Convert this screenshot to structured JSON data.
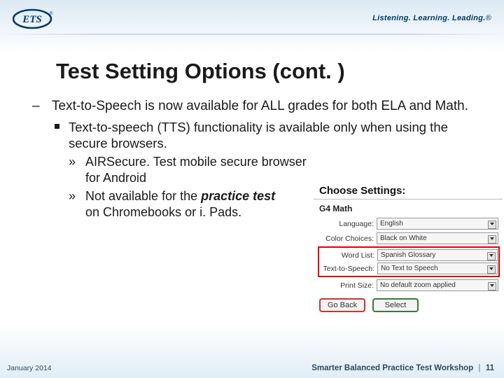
{
  "header": {
    "logo_text": "ETS",
    "tagline_1": "Listening.",
    "tagline_2": "Learning.",
    "tagline_3": "Leading.",
    "tagline_mark": "®"
  },
  "title": "Test Setting Options (cont. )",
  "bullets": {
    "l1": "Text-to-Speech is now available for ALL grades for both ELA and Math.",
    "l2": "Text-to-speech (TTS) functionality is available only when using the secure browsers.",
    "l3a_line1": "AIRSecure. Test mobile secure browser",
    "l3a_line2": "for Android",
    "l3b_line1_pre": "Not available for the ",
    "l3b_line1_em": "practice test",
    "l3b_line2": "on Chromebooks or i. Pads."
  },
  "screenshot": {
    "title": "Choose Settings:",
    "subject": "G4 Math",
    "rows": {
      "language_label": "Language:",
      "language_value": "English",
      "color_label": "Color Choices:",
      "color_value": "Black on White",
      "wordlist_label": "Word List:",
      "wordlist_value": "Spanish Glossary",
      "tts_label": "Text-to-Speech:",
      "tts_value": "No Text to Speech",
      "print_label": "Print Size:",
      "print_value": "No default zoom applied"
    },
    "buttons": {
      "back": "Go Back",
      "select": "Select"
    }
  },
  "footer": {
    "left": "January 2014",
    "right_text": "Smarter Balanced Practice Test Workshop",
    "right_sep": "|",
    "right_page": "11"
  }
}
